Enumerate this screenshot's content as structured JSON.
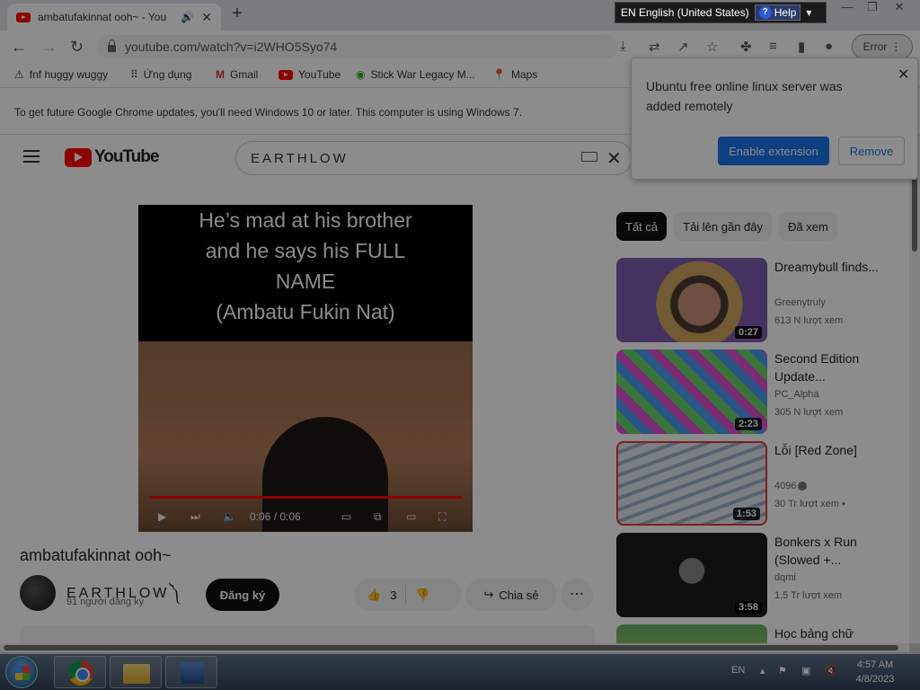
{
  "browser": {
    "tab_title": "ambatufakinnat ooh~ - You",
    "url": "youtube.com/watch?v=i2WHO5Syo74",
    "profile_button": "Error",
    "bookmarks": [
      {
        "label": "fnf huggy wuggy",
        "icon": "warning-icon"
      },
      {
        "label": "Ứng dụng",
        "icon": "apps-grid-icon"
      },
      {
        "label": "Gmail",
        "icon": "gmail-icon"
      },
      {
        "label": "YouTube",
        "icon": "youtube-icon"
      },
      {
        "label": "Stick War Legacy M...",
        "icon": "game-icon"
      },
      {
        "label": "Maps",
        "icon": "maps-pin-icon"
      }
    ],
    "info_bar": "To get future Google Chrome updates, you'll need Windows 10 or later. This computer is using Windows 7."
  },
  "langbar": {
    "lang": "EN English (United States)",
    "help": "Help"
  },
  "popup": {
    "message": "Ubuntu free online linux server was added remotely",
    "enable": "Enable extension",
    "remove": "Remove"
  },
  "youtube": {
    "logo": "YouTube",
    "search_value": "EARTHLOW",
    "video": {
      "caption_lines": [
        "He’s mad at his brother",
        "and he says his FULL",
        "NAME",
        "(Ambatu Fukin Nat)"
      ],
      "time": "0:06 / 0:06",
      "title": "ambatufakinnat ooh~"
    },
    "channel": {
      "name": "EARTHLOW༽",
      "subs": "91 người đăng ký",
      "subscribe": "Đăng ký",
      "likes": "3",
      "share": "Chia sẻ"
    },
    "chips": [
      "Tất cả",
      "Tải lên gần đây",
      "Đã xem"
    ],
    "recs": [
      {
        "title": "Dreamybull finds...",
        "channel": "Greenytruly",
        "views": "613 N lượt xem",
        "duration": "0:27"
      },
      {
        "title": "Second Edition Update...",
        "channel": "PC_Alpha",
        "views": "305 N lượt xem",
        "duration": "2:23"
      },
      {
        "title": "Lỗi [Red Zone]",
        "channel": "4096",
        "views": "30 Tr lượt xem  •",
        "duration": "1:53"
      },
      {
        "title": "Bonkers x Run (Slowed +...",
        "channel": "dqmi",
        "views": "1,5 Tr lượt xem",
        "duration": "3:58"
      },
      {
        "title": "Học bảng chữ",
        "channel": "",
        "views": "",
        "duration": ""
      }
    ]
  },
  "taskbar": {
    "lang": "EN",
    "time": "4:57 AM",
    "date": "4/8/2023"
  }
}
